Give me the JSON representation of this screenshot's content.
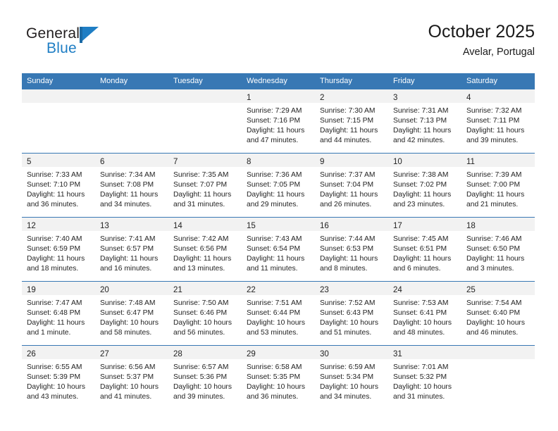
{
  "brand": {
    "name_top": "General",
    "name_bottom": "Blue",
    "flag_icon": "flag-triangle-icon",
    "color_dark": "#231f20",
    "color_blue": "#1f7ec4"
  },
  "header": {
    "title": "October 2025",
    "subtitle": "Avelar, Portugal"
  },
  "theme": {
    "header_band": "#3878b4",
    "day_band": "#f2f2f2",
    "text": "#232323"
  },
  "weekday_headers": [
    "Sunday",
    "Monday",
    "Tuesday",
    "Wednesday",
    "Thursday",
    "Friday",
    "Saturday"
  ],
  "weeks": [
    [
      {
        "day": "",
        "sunrise": "",
        "sunset": "",
        "daylight1": "",
        "daylight2": "",
        "empty": true
      },
      {
        "day": "",
        "sunrise": "",
        "sunset": "",
        "daylight1": "",
        "daylight2": "",
        "empty": true
      },
      {
        "day": "",
        "sunrise": "",
        "sunset": "",
        "daylight1": "",
        "daylight2": "",
        "empty": true
      },
      {
        "day": "1",
        "sunrise": "Sunrise: 7:29 AM",
        "sunset": "Sunset: 7:16 PM",
        "daylight1": "Daylight: 11 hours",
        "daylight2": "and 47 minutes.",
        "empty": false
      },
      {
        "day": "2",
        "sunrise": "Sunrise: 7:30 AM",
        "sunset": "Sunset: 7:15 PM",
        "daylight1": "Daylight: 11 hours",
        "daylight2": "and 44 minutes.",
        "empty": false
      },
      {
        "day": "3",
        "sunrise": "Sunrise: 7:31 AM",
        "sunset": "Sunset: 7:13 PM",
        "daylight1": "Daylight: 11 hours",
        "daylight2": "and 42 minutes.",
        "empty": false
      },
      {
        "day": "4",
        "sunrise": "Sunrise: 7:32 AM",
        "sunset": "Sunset: 7:11 PM",
        "daylight1": "Daylight: 11 hours",
        "daylight2": "and 39 minutes.",
        "empty": false
      }
    ],
    [
      {
        "day": "5",
        "sunrise": "Sunrise: 7:33 AM",
        "sunset": "Sunset: 7:10 PM",
        "daylight1": "Daylight: 11 hours",
        "daylight2": "and 36 minutes.",
        "empty": false
      },
      {
        "day": "6",
        "sunrise": "Sunrise: 7:34 AM",
        "sunset": "Sunset: 7:08 PM",
        "daylight1": "Daylight: 11 hours",
        "daylight2": "and 34 minutes.",
        "empty": false
      },
      {
        "day": "7",
        "sunrise": "Sunrise: 7:35 AM",
        "sunset": "Sunset: 7:07 PM",
        "daylight1": "Daylight: 11 hours",
        "daylight2": "and 31 minutes.",
        "empty": false
      },
      {
        "day": "8",
        "sunrise": "Sunrise: 7:36 AM",
        "sunset": "Sunset: 7:05 PM",
        "daylight1": "Daylight: 11 hours",
        "daylight2": "and 29 minutes.",
        "empty": false
      },
      {
        "day": "9",
        "sunrise": "Sunrise: 7:37 AM",
        "sunset": "Sunset: 7:04 PM",
        "daylight1": "Daylight: 11 hours",
        "daylight2": "and 26 minutes.",
        "empty": false
      },
      {
        "day": "10",
        "sunrise": "Sunrise: 7:38 AM",
        "sunset": "Sunset: 7:02 PM",
        "daylight1": "Daylight: 11 hours",
        "daylight2": "and 23 minutes.",
        "empty": false
      },
      {
        "day": "11",
        "sunrise": "Sunrise: 7:39 AM",
        "sunset": "Sunset: 7:00 PM",
        "daylight1": "Daylight: 11 hours",
        "daylight2": "and 21 minutes.",
        "empty": false
      }
    ],
    [
      {
        "day": "12",
        "sunrise": "Sunrise: 7:40 AM",
        "sunset": "Sunset: 6:59 PM",
        "daylight1": "Daylight: 11 hours",
        "daylight2": "and 18 minutes.",
        "empty": false
      },
      {
        "day": "13",
        "sunrise": "Sunrise: 7:41 AM",
        "sunset": "Sunset: 6:57 PM",
        "daylight1": "Daylight: 11 hours",
        "daylight2": "and 16 minutes.",
        "empty": false
      },
      {
        "day": "14",
        "sunrise": "Sunrise: 7:42 AM",
        "sunset": "Sunset: 6:56 PM",
        "daylight1": "Daylight: 11 hours",
        "daylight2": "and 13 minutes.",
        "empty": false
      },
      {
        "day": "15",
        "sunrise": "Sunrise: 7:43 AM",
        "sunset": "Sunset: 6:54 PM",
        "daylight1": "Daylight: 11 hours",
        "daylight2": "and 11 minutes.",
        "empty": false
      },
      {
        "day": "16",
        "sunrise": "Sunrise: 7:44 AM",
        "sunset": "Sunset: 6:53 PM",
        "daylight1": "Daylight: 11 hours",
        "daylight2": "and 8 minutes.",
        "empty": false
      },
      {
        "day": "17",
        "sunrise": "Sunrise: 7:45 AM",
        "sunset": "Sunset: 6:51 PM",
        "daylight1": "Daylight: 11 hours",
        "daylight2": "and 6 minutes.",
        "empty": false
      },
      {
        "day": "18",
        "sunrise": "Sunrise: 7:46 AM",
        "sunset": "Sunset: 6:50 PM",
        "daylight1": "Daylight: 11 hours",
        "daylight2": "and 3 minutes.",
        "empty": false
      }
    ],
    [
      {
        "day": "19",
        "sunrise": "Sunrise: 7:47 AM",
        "sunset": "Sunset: 6:48 PM",
        "daylight1": "Daylight: 11 hours",
        "daylight2": "and 1 minute.",
        "empty": false
      },
      {
        "day": "20",
        "sunrise": "Sunrise: 7:48 AM",
        "sunset": "Sunset: 6:47 PM",
        "daylight1": "Daylight: 10 hours",
        "daylight2": "and 58 minutes.",
        "empty": false
      },
      {
        "day": "21",
        "sunrise": "Sunrise: 7:50 AM",
        "sunset": "Sunset: 6:46 PM",
        "daylight1": "Daylight: 10 hours",
        "daylight2": "and 56 minutes.",
        "empty": false
      },
      {
        "day": "22",
        "sunrise": "Sunrise: 7:51 AM",
        "sunset": "Sunset: 6:44 PM",
        "daylight1": "Daylight: 10 hours",
        "daylight2": "and 53 minutes.",
        "empty": false
      },
      {
        "day": "23",
        "sunrise": "Sunrise: 7:52 AM",
        "sunset": "Sunset: 6:43 PM",
        "daylight1": "Daylight: 10 hours",
        "daylight2": "and 51 minutes.",
        "empty": false
      },
      {
        "day": "24",
        "sunrise": "Sunrise: 7:53 AM",
        "sunset": "Sunset: 6:41 PM",
        "daylight1": "Daylight: 10 hours",
        "daylight2": "and 48 minutes.",
        "empty": false
      },
      {
        "day": "25",
        "sunrise": "Sunrise: 7:54 AM",
        "sunset": "Sunset: 6:40 PM",
        "daylight1": "Daylight: 10 hours",
        "daylight2": "and 46 minutes.",
        "empty": false
      }
    ],
    [
      {
        "day": "26",
        "sunrise": "Sunrise: 6:55 AM",
        "sunset": "Sunset: 5:39 PM",
        "daylight1": "Daylight: 10 hours",
        "daylight2": "and 43 minutes.",
        "empty": false
      },
      {
        "day": "27",
        "sunrise": "Sunrise: 6:56 AM",
        "sunset": "Sunset: 5:37 PM",
        "daylight1": "Daylight: 10 hours",
        "daylight2": "and 41 minutes.",
        "empty": false
      },
      {
        "day": "28",
        "sunrise": "Sunrise: 6:57 AM",
        "sunset": "Sunset: 5:36 PM",
        "daylight1": "Daylight: 10 hours",
        "daylight2": "and 39 minutes.",
        "empty": false
      },
      {
        "day": "29",
        "sunrise": "Sunrise: 6:58 AM",
        "sunset": "Sunset: 5:35 PM",
        "daylight1": "Daylight: 10 hours",
        "daylight2": "and 36 minutes.",
        "empty": false
      },
      {
        "day": "30",
        "sunrise": "Sunrise: 6:59 AM",
        "sunset": "Sunset: 5:34 PM",
        "daylight1": "Daylight: 10 hours",
        "daylight2": "and 34 minutes.",
        "empty": false
      },
      {
        "day": "31",
        "sunrise": "Sunrise: 7:01 AM",
        "sunset": "Sunset: 5:32 PM",
        "daylight1": "Daylight: 10 hours",
        "daylight2": "and 31 minutes.",
        "empty": false
      },
      {
        "day": "",
        "sunrise": "",
        "sunset": "",
        "daylight1": "",
        "daylight2": "",
        "empty": true
      }
    ]
  ]
}
